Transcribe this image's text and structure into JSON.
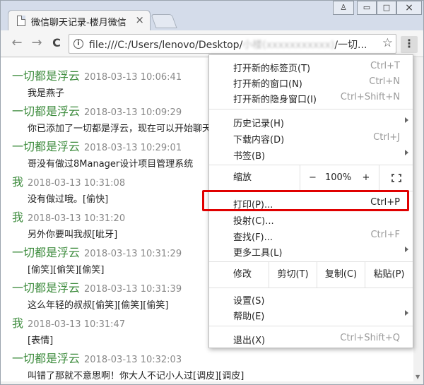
{
  "window": {
    "controls": {
      "user": "♙",
      "minimize": "▭",
      "maximize": "□",
      "close": "×"
    }
  },
  "tab": {
    "title": "微信聊天记录-楼月微信",
    "close": "×"
  },
  "toolbar": {
    "back": "←",
    "forward": "→",
    "reload": "C",
    "url_prefix": "file:///C:/Users/lenovo/Desktop/",
    "url_blurred": "小楼(xxxxxxxxxxx)",
    "url_suffix": "/一切...",
    "info": "i",
    "bookmark": "☆",
    "menu": "⋮"
  },
  "messages": [
    {
      "name": "一切都是浮云",
      "time": "2018-03-13 10:06:41",
      "text": "我是燕子"
    },
    {
      "name": "一切都是浮云",
      "time": "2018-03-13 10:09:29",
      "text": "你已添加了一切都是浮云，现在可以开始聊天"
    },
    {
      "name": "一切都是浮云",
      "time": "2018-03-13 10:29:01",
      "text": "哥没有做过8Manager设计项目管理系统"
    },
    {
      "name": "我",
      "time": "2018-03-13 10:31:08",
      "text": "没有做过哦。[偷快]"
    },
    {
      "name": "我",
      "time": "2018-03-13 10:31:20",
      "text": "另外你要叫我叔[呲牙]"
    },
    {
      "name": "一切都是浮云",
      "time": "2018-03-13 10:31:29",
      "text": "[偷笑][偷笑][偷笑]"
    },
    {
      "name": "一切都是浮云",
      "time": "2018-03-13 10:31:39",
      "text": "这么年轻的叔叔[偷笑][偷笑][偷笑]"
    },
    {
      "name": "我",
      "time": "2018-03-13 10:31:47",
      "text": "[表情]"
    },
    {
      "name": "一切都是浮云",
      "time": "2018-03-13 10:32:03",
      "text": "叫错了那就不意思啊！你大人不记小人过[调皮][调皮]"
    }
  ],
  "menu": {
    "new_tab": {
      "label": "打开新的标签页(T)",
      "shortcut": "Ctrl+T"
    },
    "new_window": {
      "label": "打开新的窗口(N)",
      "shortcut": "Ctrl+N"
    },
    "new_incognito": {
      "label": "打开新的隐身窗口(I)",
      "shortcut": "Ctrl+Shift+N"
    },
    "history": {
      "label": "历史记录(H)"
    },
    "downloads": {
      "label": "下载内容(D)",
      "shortcut": "Ctrl+J"
    },
    "bookmarks": {
      "label": "书签(B)"
    },
    "zoom": {
      "label": "缩放",
      "minus": "−",
      "value": "100%",
      "plus": "+"
    },
    "print": {
      "label": "打印(P)...",
      "shortcut": "Ctrl+P"
    },
    "cast": {
      "label": "投射(C)..."
    },
    "find": {
      "label": "查找(F)...",
      "shortcut": "Ctrl+F"
    },
    "more_tools": {
      "label": "更多工具(L)"
    },
    "edit": {
      "label": "修改",
      "cut": "剪切(T)",
      "copy": "复制(C)",
      "paste": "粘贴(P)"
    },
    "settings": {
      "label": "设置(S)"
    },
    "help": {
      "label": "帮助(E)"
    },
    "exit": {
      "label": "退出(X)",
      "shortcut": "Ctrl+Shift+Q"
    }
  },
  "colors": {
    "name_green": "#3c8b3c",
    "highlight_red": "#e00000"
  }
}
